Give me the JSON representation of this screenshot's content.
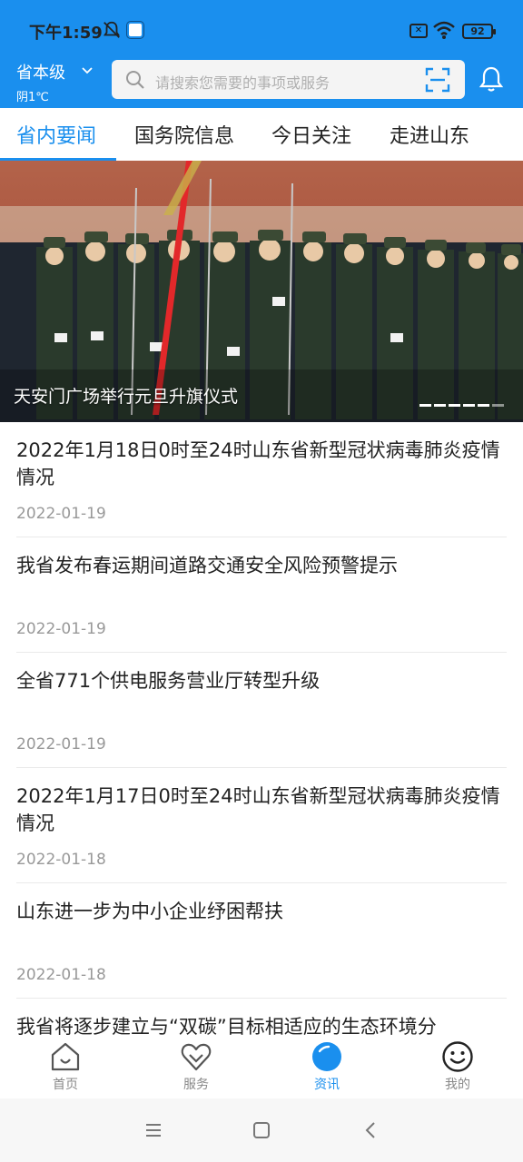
{
  "status": {
    "time": "下午1:59",
    "battery": "92",
    "sim_mark": "✕"
  },
  "header": {
    "region_name": "省本级",
    "weather": "阴1℃",
    "search_placeholder": "请搜索您需要的事项或服务"
  },
  "tabs": [
    {
      "label": "省内要闻",
      "active": true
    },
    {
      "label": "国务院信息",
      "active": false
    },
    {
      "label": "今日关注",
      "active": false
    },
    {
      "label": "走进山东",
      "active": false
    }
  ],
  "banner": {
    "caption": "天安门广场举行元旦升旗仪式",
    "slide_count": 6,
    "active_slide": 5
  },
  "news": [
    {
      "title": "2022年1月18日0时至24时山东省新型冠状病毒肺炎疫情情况",
      "date": "2022-01-19"
    },
    {
      "title": "我省发布春运期间道路交通安全风险预警提示",
      "date": "2022-01-19"
    },
    {
      "title": "全省771个供电服务营业厅转型升级",
      "date": "2022-01-19"
    },
    {
      "title": "2022年1月17日0时至24时山东省新型冠状病毒肺炎疫情情况",
      "date": "2022-01-18"
    },
    {
      "title": "山东进一步为中小企业纾困帮扶",
      "date": "2022-01-18"
    },
    {
      "title": "我省将逐步建立与“双碳”目标相适应的生态环境分",
      "date": ""
    }
  ],
  "bottom_nav": [
    {
      "label": "首页",
      "icon": "home-icon",
      "active": false
    },
    {
      "label": "服务",
      "icon": "heart-icon",
      "active": false
    },
    {
      "label": "资讯",
      "icon": "news-icon",
      "active": true
    },
    {
      "label": "我的",
      "icon": "smiley-icon",
      "active": false
    }
  ],
  "colors": {
    "brand": "#1a8fee",
    "inactive": "#888888"
  }
}
